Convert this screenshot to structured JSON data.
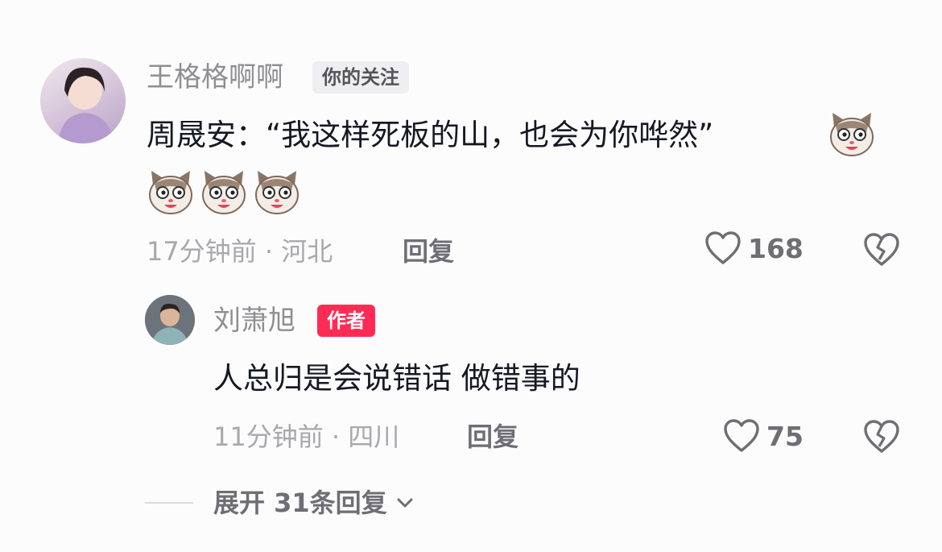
{
  "comments": [
    {
      "user": "王格格啊啊",
      "badge": "你的关注",
      "text_line1": "周晟安：“我这样死板的山，也会为你哗然”",
      "time_location": "17分钟前 · 河北",
      "reply_label": "回复",
      "likes": "168",
      "emoji": "cat-face-emoji",
      "emoji_count": 4
    }
  ],
  "reply": {
    "user": "刘萧旭",
    "badge": "作者",
    "text": "人总归是会说错话 做错事的",
    "time_location": "11分钟前 · 四川",
    "reply_label": "回复",
    "likes": "75"
  },
  "expand": {
    "label": "展开 31条回复"
  },
  "icons": {
    "like": "heart-outline-icon",
    "dislike": "broken-heart-icon",
    "chevron": "chevron-down-icon"
  },
  "colors": {
    "author_badge": "#fe2c55",
    "follow_badge_bg": "#efeff1",
    "text": "#161823",
    "meta": "#a8a8ad"
  }
}
